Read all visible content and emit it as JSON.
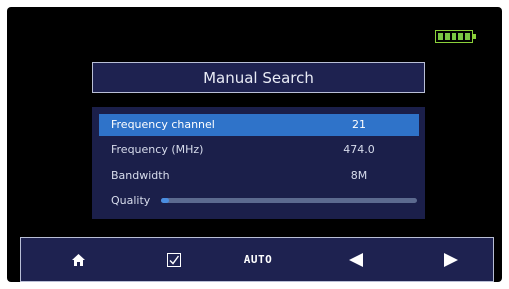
{
  "status": {
    "battery_level": 1.0,
    "battery_color": "#7ac943"
  },
  "header": {
    "title": "Manual Search"
  },
  "settings": {
    "rows": [
      {
        "label": "Frequency channel",
        "value": "21",
        "selected": true
      },
      {
        "label": "Frequency (MHz)",
        "value": "474.0",
        "selected": false
      },
      {
        "label": "Bandwidth",
        "value": "8M",
        "selected": false
      }
    ],
    "quality": {
      "label": "Quality",
      "level": 0.03
    }
  },
  "toolbar": {
    "buttons": [
      {
        "name": "home-button",
        "icon": "home-icon"
      },
      {
        "name": "confirm-button",
        "icon": "checkbox-icon"
      },
      {
        "name": "auto-button",
        "label": "AUTO"
      },
      {
        "name": "prev-button",
        "icon": "arrow-left-icon"
      },
      {
        "name": "next-button",
        "icon": "arrow-right-icon"
      }
    ]
  },
  "colors": {
    "accent": "#2f73c9",
    "panel": "#1b1f4a",
    "frame": "#b9bfd6"
  }
}
